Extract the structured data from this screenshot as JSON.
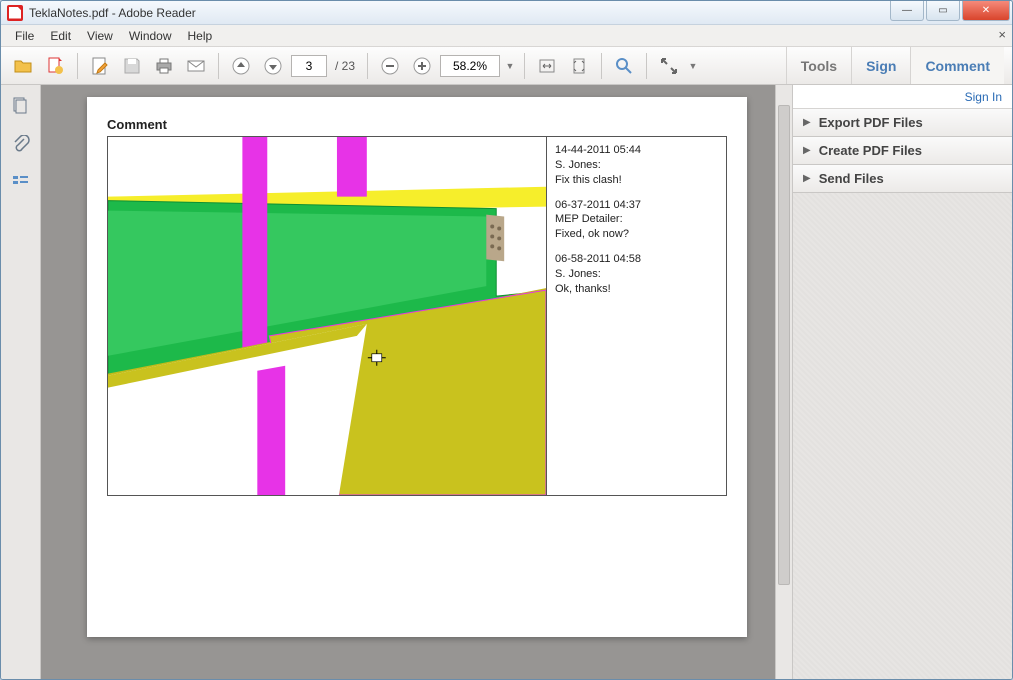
{
  "window": {
    "title": "TeklaNotes.pdf - Adobe Reader"
  },
  "menu": {
    "file": "File",
    "edit": "Edit",
    "view": "View",
    "window": "Window",
    "help": "Help"
  },
  "toolbar": {
    "page_current": "3",
    "page_total": "/ 23",
    "zoom": "58.2%"
  },
  "right_tabs": {
    "tools": "Tools",
    "sign": "Sign",
    "comment": "Comment"
  },
  "rightpanel": {
    "signin": "Sign In",
    "export": "Export PDF Files",
    "create": "Create PDF Files",
    "send": "Send Files"
  },
  "document": {
    "comment_heading": "Comment",
    "notes": [
      {
        "ts": "14-44-2011 05:44",
        "author": "S. Jones:",
        "text": "Fix this clash!"
      },
      {
        "ts": "06-37-2011 04:37",
        "author": "MEP Detailer:",
        "text": "Fixed, ok now?"
      },
      {
        "ts": "06-58-2011 04:58",
        "author": "S. Jones:",
        "text": "Ok, thanks!"
      }
    ]
  }
}
